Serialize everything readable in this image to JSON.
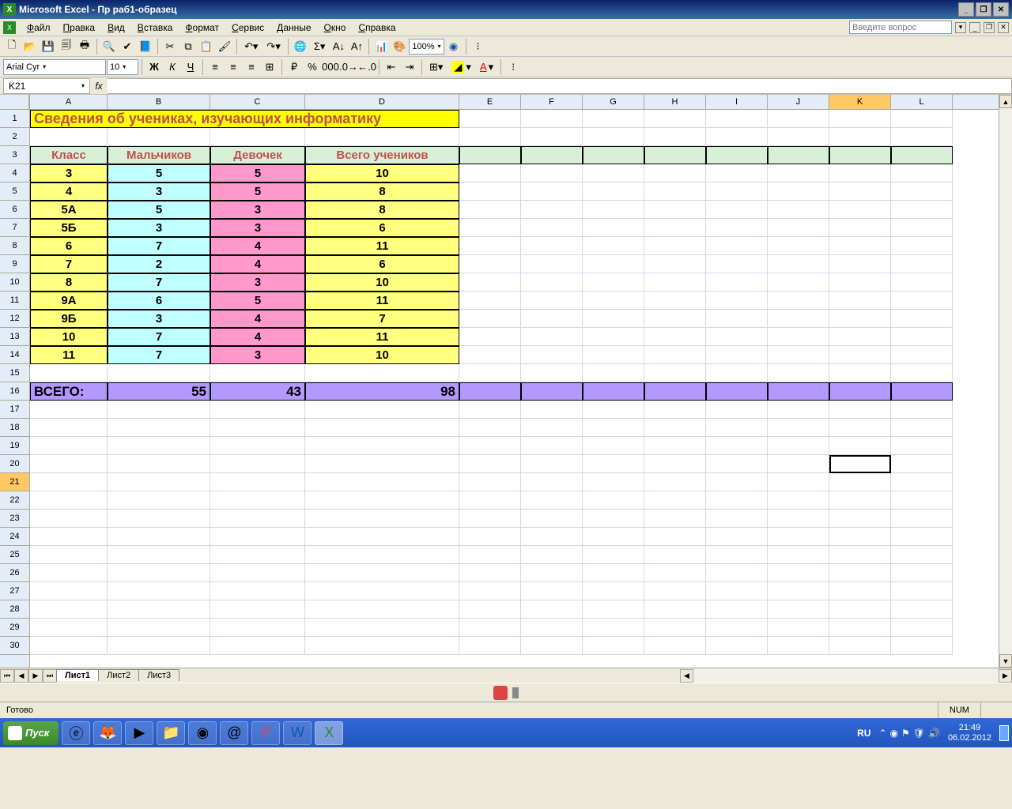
{
  "app": {
    "titlebar": "Microsoft Excel - Пр раб1-образец"
  },
  "menu": {
    "items": [
      "Файл",
      "Правка",
      "Вид",
      "Вставка",
      "Формат",
      "Сервис",
      "Данные",
      "Окно",
      "Справка"
    ],
    "ask_placeholder": "Введите вопрос"
  },
  "toolbar1": {
    "zoom": "100%"
  },
  "toolbar2": {
    "font": "Arial Cyr",
    "size": "10"
  },
  "namebox": "K21",
  "formula": "",
  "columns": [
    "A",
    "B",
    "C",
    "D",
    "E",
    "F",
    "G",
    "H",
    "I",
    "J",
    "K",
    "L"
  ],
  "col_widths": [
    "c-A",
    "c-B",
    "c-C",
    "c-D",
    "c-std",
    "c-std",
    "c-std",
    "c-std",
    "c-std",
    "c-std",
    "c-std",
    "c-std"
  ],
  "row_count": 30,
  "active": {
    "row": 21,
    "col": "K"
  },
  "sheet": {
    "title": "Сведения об учениках, изучающих информатику",
    "headers": [
      "Класс",
      "Мальчиков",
      "Девочек",
      "Всего учеников"
    ],
    "rows": [
      [
        "3",
        "5",
        "5",
        "10"
      ],
      [
        "4",
        "3",
        "5",
        "8"
      ],
      [
        "5А",
        "5",
        "3",
        "8"
      ],
      [
        "5Б",
        "3",
        "3",
        "6"
      ],
      [
        "6",
        "7",
        "4",
        "11"
      ],
      [
        "7",
        "2",
        "4",
        "6"
      ],
      [
        "8",
        "7",
        "3",
        "10"
      ],
      [
        "9А",
        "6",
        "5",
        "11"
      ],
      [
        "9Б",
        "3",
        "4",
        "7"
      ],
      [
        "10",
        "7",
        "4",
        "11"
      ],
      [
        "11",
        "7",
        "3",
        "10"
      ]
    ],
    "total_label": "ВСЕГО:",
    "totals": [
      "55",
      "43",
      "98"
    ]
  },
  "tabs": {
    "list": [
      "Лист1",
      "Лист2",
      "Лист3"
    ],
    "active": 0
  },
  "status": {
    "ready": "Готово",
    "num": "NUM"
  },
  "taskbar": {
    "start": "Пуск",
    "lang": "RU",
    "time": "21:49",
    "date": "06.02.2012"
  },
  "chart_data": {
    "type": "table",
    "title": "Сведения об учениках, изучающих информатику",
    "columns": [
      "Класс",
      "Мальчиков",
      "Девочек",
      "Всего учеников"
    ],
    "rows": [
      {
        "Класс": "3",
        "Мальчиков": 5,
        "Девочек": 5,
        "Всего учеников": 10
      },
      {
        "Класс": "4",
        "Мальчиков": 3,
        "Девочек": 5,
        "Всего учеников": 8
      },
      {
        "Класс": "5А",
        "Мальчиков": 5,
        "Девочек": 3,
        "Всего учеников": 8
      },
      {
        "Класс": "5Б",
        "Мальчиков": 3,
        "Девочек": 3,
        "Всего учеников": 6
      },
      {
        "Класс": "6",
        "Мальчиков": 7,
        "Девочек": 4,
        "Всего учеников": 11
      },
      {
        "Класс": "7",
        "Мальчиков": 2,
        "Девочек": 4,
        "Всего учеников": 6
      },
      {
        "Класс": "8",
        "Мальчиков": 7,
        "Девочек": 3,
        "Всего учеников": 10
      },
      {
        "Класс": "9А",
        "Мальчиков": 6,
        "Девочек": 5,
        "Всего учеников": 11
      },
      {
        "Класс": "9Б",
        "Мальчиков": 3,
        "Девочек": 4,
        "Всего учеников": 7
      },
      {
        "Класс": "10",
        "Мальчиков": 7,
        "Девочек": 4,
        "Всего учеников": 11
      },
      {
        "Класс": "11",
        "Мальчиков": 7,
        "Девочек": 3,
        "Всего учеников": 10
      }
    ],
    "totals": {
      "Мальчиков": 55,
      "Девочек": 43,
      "Всего учеников": 98
    }
  }
}
